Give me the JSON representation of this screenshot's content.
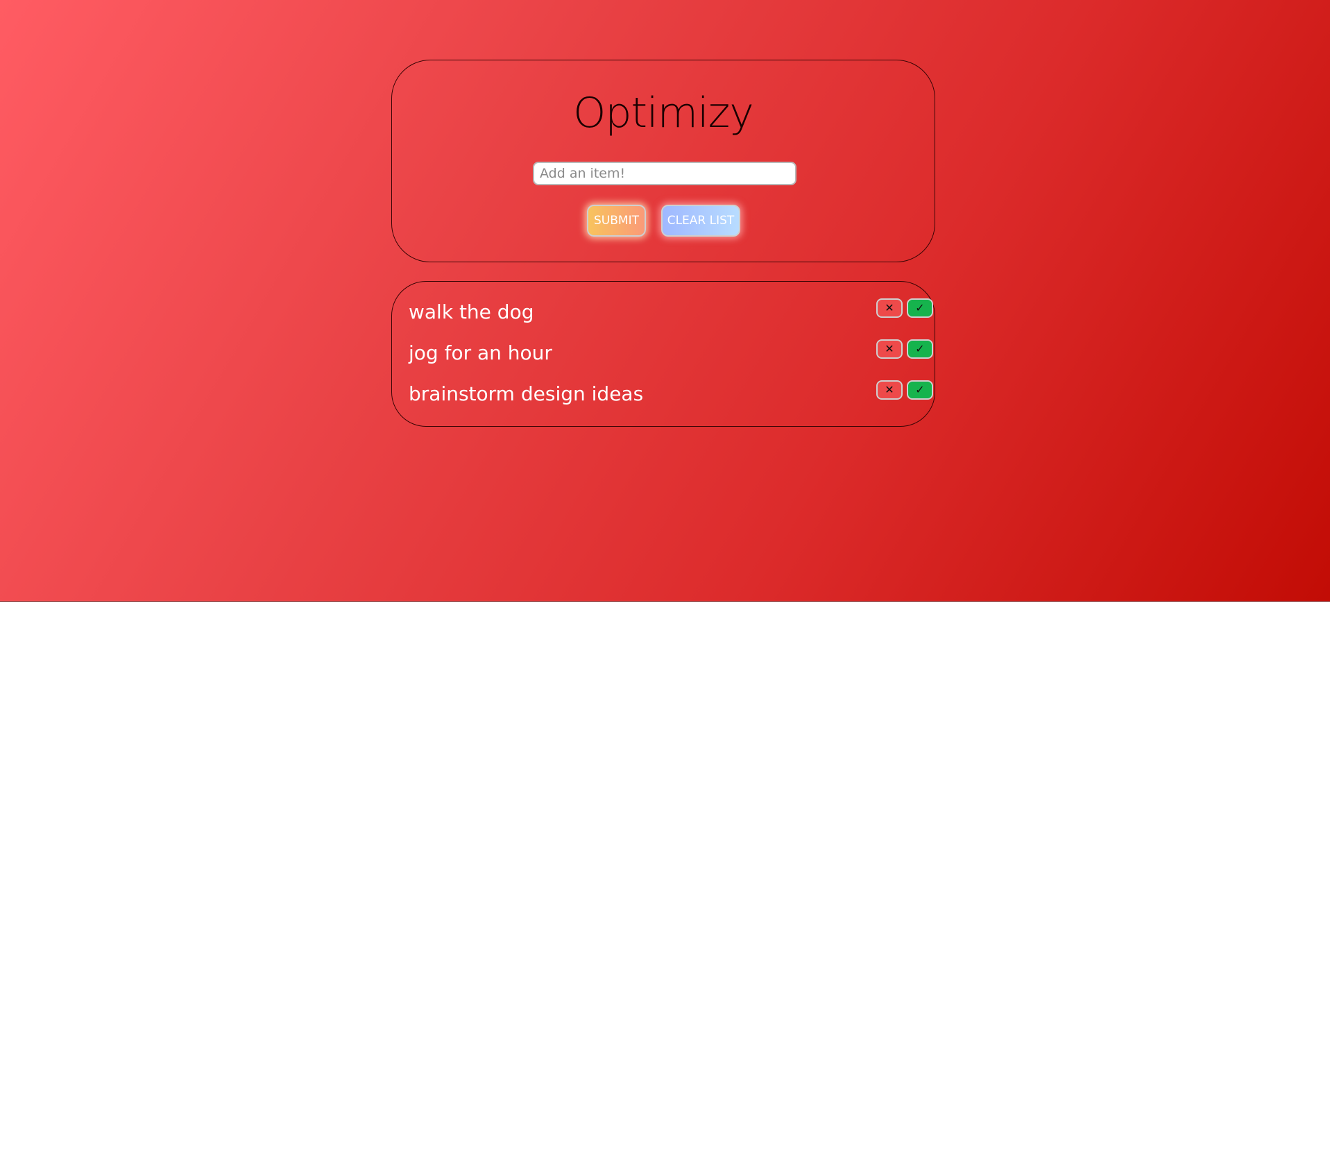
{
  "header": {
    "title": "Optimizy"
  },
  "form": {
    "input_placeholder": "Add an item!",
    "input_value": "",
    "submit_label": "SUBMIT",
    "clear_label": "CLEAR LIST"
  },
  "list": {
    "items": [
      {
        "text": "walk the dog",
        "remove_glyph": "✕",
        "done_glyph": "✓"
      },
      {
        "text": "jog for an hour",
        "remove_glyph": "✕",
        "done_glyph": "✓"
      },
      {
        "text": "brainstorm design ideas",
        "remove_glyph": "✕",
        "done_glyph": "✓"
      }
    ]
  },
  "icons": {
    "remove": "close-icon",
    "done": "check-icon"
  },
  "colors": {
    "background_start": "#ff5c63",
    "background_end": "#c20c05",
    "remove_button": "#ee4a4a",
    "done_button": "#16b34d",
    "submit_start": "#f8c35e",
    "submit_end": "#fa9a78",
    "clear_start": "#9fb8ff",
    "clear_end": "#b8dcff"
  }
}
